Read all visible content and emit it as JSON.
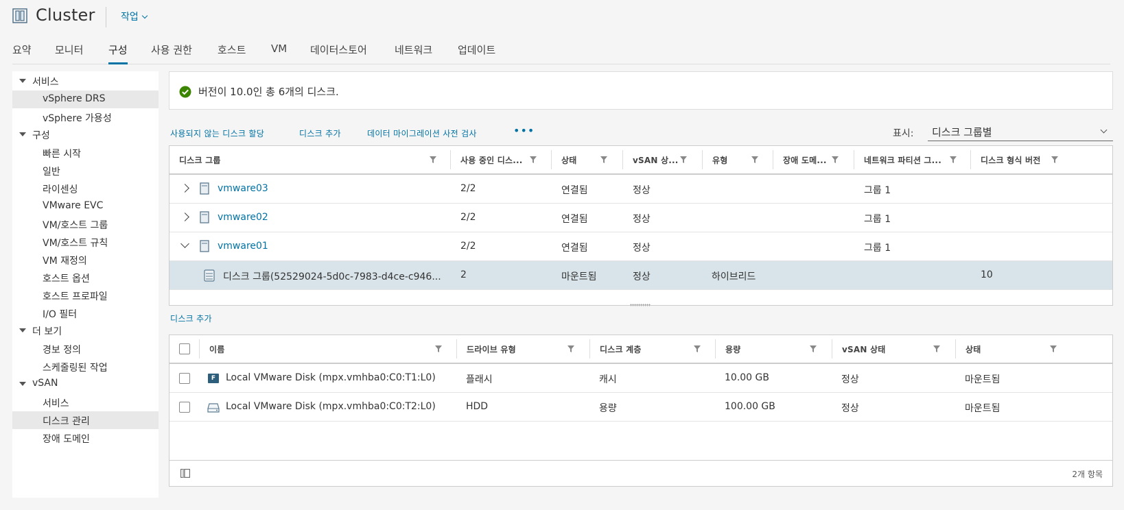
{
  "header": {
    "title": "Cluster",
    "actions_label": "작업"
  },
  "tabs": [
    "요약",
    "모니터",
    "구성",
    "사용 권한",
    "호스트",
    "VM",
    "데이터스토어",
    "네트워크",
    "업데이트"
  ],
  "active_tab": "구성",
  "sidebar": {
    "groups": [
      {
        "label": "서비스",
        "items": [
          "vSphere DRS",
          "vSphere 가용성"
        ]
      },
      {
        "label": "구성",
        "items": [
          "빠른 시작",
          "일반",
          "라이센싱",
          "VMware EVC",
          "VM/호스트 그룹",
          "VM/호스트 규칙",
          "VM 재정의",
          "호스트 옵션",
          "호스트 프로파일",
          "I/O 필터"
        ]
      },
      {
        "label": "더 보기",
        "items": [
          "경보 정의",
          "스케줄링된 작업"
        ]
      },
      {
        "label": "vSAN",
        "items": [
          "서비스",
          "디스크 관리",
          "장애 도메인"
        ]
      }
    ],
    "selected": [
      "vSphere DRS",
      "디스크 관리"
    ]
  },
  "alert": {
    "text": "버전이 10.0인 총 6개의 디스크."
  },
  "toolbar": {
    "claim_unused": "사용되지 않는 디스크 할당",
    "add_disk": "디스크 추가",
    "precheck": "데이터 마이그레이션 사전 검사",
    "more": "•••",
    "show_label": "표시:",
    "show_value": "디스크 그룹별"
  },
  "disk_group_grid": {
    "columns": [
      "디스크 그룹",
      "사용 중인 디스...",
      "상태",
      "vSAN 상...",
      "유형",
      "장애 도메...",
      "네트워크 파티션 그...",
      "디스크 형식 버전"
    ],
    "rows": [
      {
        "name": "vmware03",
        "in_use": "2/2",
        "state": "연결됨",
        "vsan": "정상",
        "type": "",
        "fault": "",
        "partition": "그룹 1",
        "format": ""
      },
      {
        "name": "vmware02",
        "in_use": "2/2",
        "state": "연결됨",
        "vsan": "정상",
        "type": "",
        "fault": "",
        "partition": "그룹 1",
        "format": ""
      },
      {
        "name": "vmware01",
        "in_use": "2/2",
        "state": "연결됨",
        "vsan": "정상",
        "type": "",
        "fault": "",
        "partition": "그룹 1",
        "format": ""
      }
    ],
    "child_row": {
      "name": "디스크 그룹(52529024-5d0c-7983-d4ce-c946...",
      "in_use": "2",
      "state": "마운트됨",
      "vsan": "정상",
      "type": "하이브리드",
      "fault": "",
      "partition": "",
      "format": "10"
    }
  },
  "add_disk_link": "디스크 추가",
  "disk_grid": {
    "columns": [
      "이름",
      "드라이브 유형",
      "디스크 계층",
      "용량",
      "vSAN 상태",
      "상태"
    ],
    "rows": [
      {
        "icon": "flash-icon",
        "icon_letter": "F",
        "name": "Local VMware Disk (mpx.vmhba0:C0:T1:L0)",
        "drive_type": "플래시",
        "tier": "캐시",
        "capacity": "10.00 GB",
        "vsan": "정상",
        "state": "마운트됨"
      },
      {
        "icon": "hdd-icon",
        "name": "Local VMware Disk (mpx.vmhba0:C0:T2:L0)",
        "drive_type": "HDD",
        "tier": "용량",
        "capacity": "100.00 GB",
        "vsan": "정상",
        "state": "마운트됨"
      }
    ],
    "footer_count": "2개 항목"
  },
  "colors": {
    "accent": "#0072a3",
    "success": "#3c8500",
    "selected_row": "#d9e4ea",
    "flash_icon": "#2d5f7c"
  }
}
